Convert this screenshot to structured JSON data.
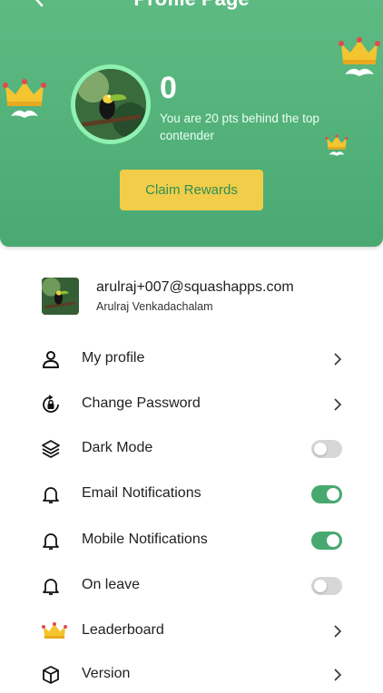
{
  "header": {
    "title": "Profile Page",
    "points": "0",
    "behind_text": "You are 20 pts behind the top contender",
    "claim_label": "Claim Rewards"
  },
  "user": {
    "email": "arulraj+007@squashapps.com",
    "name": "Arulraj Venkadachalam"
  },
  "menu": [
    {
      "label": "My profile",
      "icon": "person-icon",
      "control": "chevron"
    },
    {
      "label": "Change Password",
      "icon": "lock-rotate-icon",
      "control": "chevron"
    },
    {
      "label": "Dark Mode",
      "icon": "layers-icon",
      "control": "toggle",
      "on": false
    },
    {
      "label": "Email Notifications",
      "icon": "bell-icon",
      "control": "toggle",
      "on": true
    },
    {
      "label": "Mobile Notifications",
      "icon": "bell-icon",
      "control": "toggle",
      "on": true
    },
    {
      "label": "On leave",
      "icon": "bell-icon",
      "control": "toggle",
      "on": false
    },
    {
      "label": "Leaderboard",
      "icon": "crown-icon",
      "control": "chevron"
    },
    {
      "label": "Version",
      "icon": "cube-icon",
      "control": "chevron"
    }
  ],
  "colors": {
    "header_green": "#4aa972",
    "ring_green": "#8ff0b3",
    "claim_yellow": "#f1cd4a",
    "toggle_on": "#47a96f",
    "toggle_off": "#d7d7d7"
  }
}
